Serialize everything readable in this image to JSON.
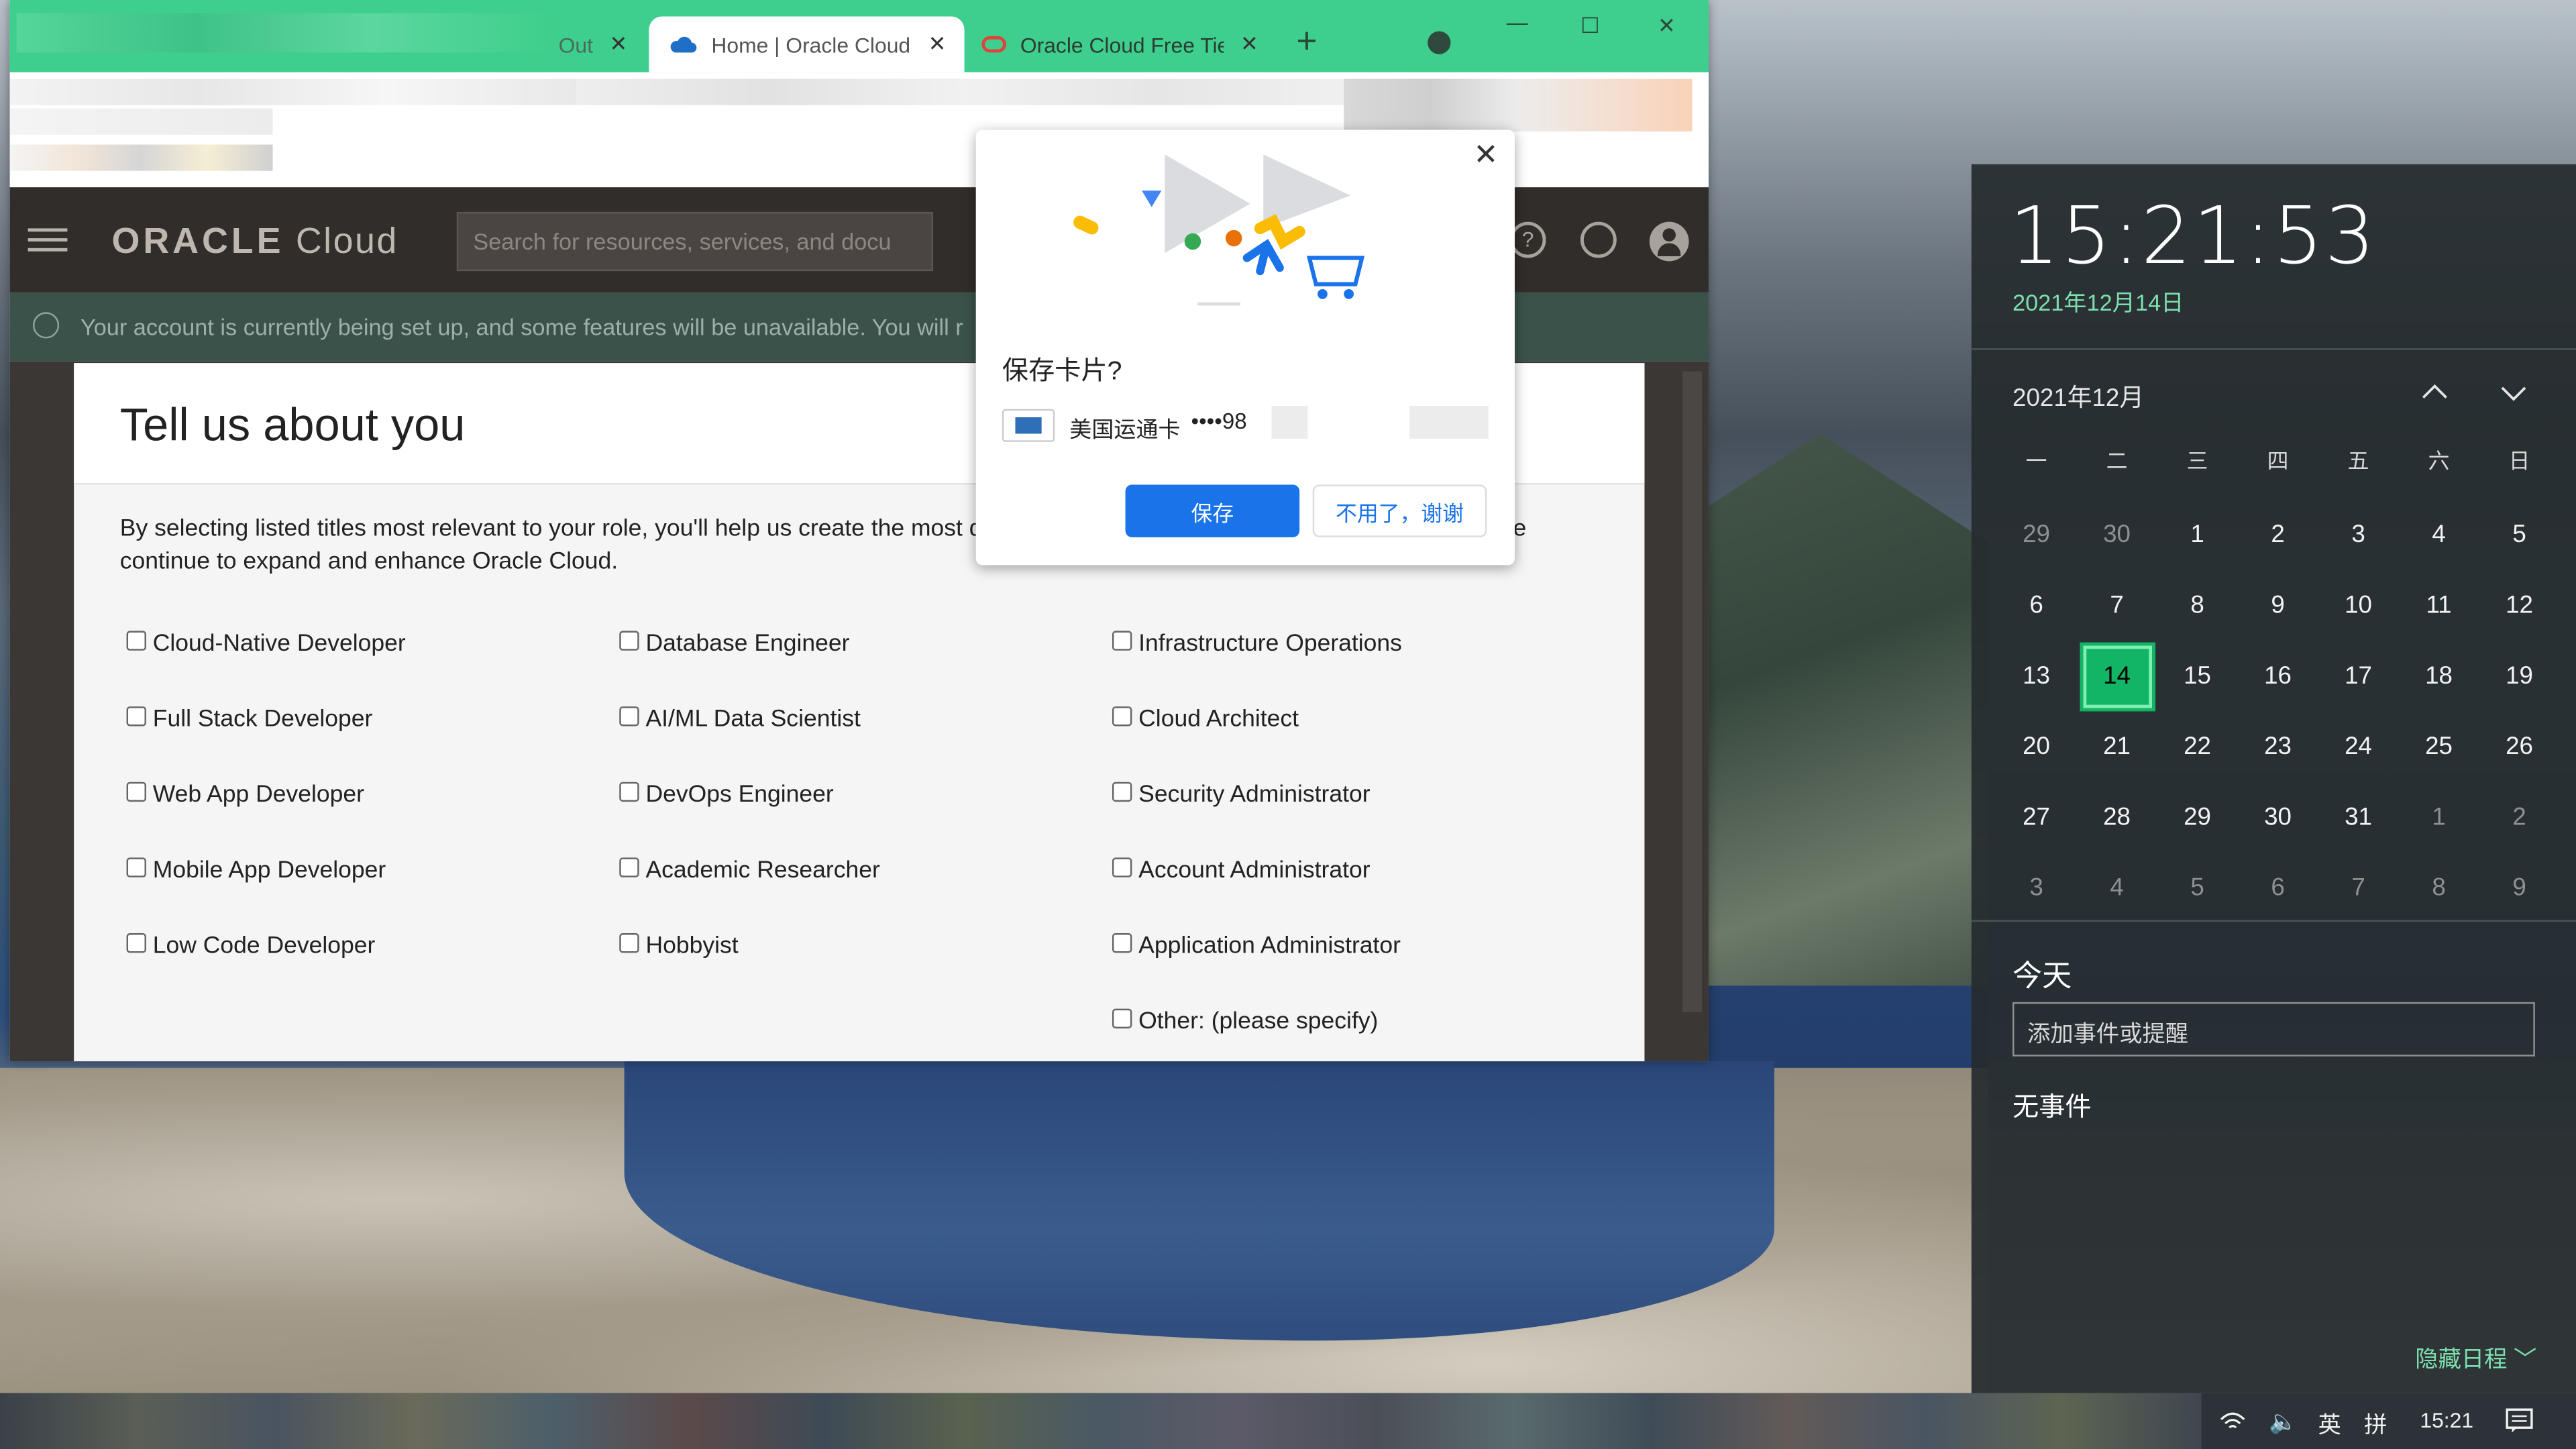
{
  "browser": {
    "tabs": [
      {
        "title": "Out"
      },
      {
        "title": "Home | Oracle Cloud"
      },
      {
        "title": "Oracle Cloud Free Tie"
      }
    ],
    "new_tab": "+",
    "controls": {
      "minimize": "—",
      "maximize": "☐",
      "close": "✕"
    }
  },
  "oracle": {
    "logo_oracle": "ORACLE",
    "logo_cloud": " Cloud",
    "search_placeholder": "Search for resources, services, and docu",
    "notice": "Your account is currently being set up, and some features will be unavailable. You will r"
  },
  "modal": {
    "title": "Tell us about you",
    "intro_line1": "By selecting listed titles most relevant to your role, you'll help us create the most di",
    "intro_line1_tail": "e",
    "intro_line2": "continue to expand and enhance Oracle Cloud.",
    "options": [
      [
        "Cloud-Native Developer",
        "Database Engineer",
        "Infrastructure Operations"
      ],
      [
        "Full Stack Developer",
        "AI/ML Data Scientist",
        "Cloud Architect"
      ],
      [
        "Web App Developer",
        "DevOps Engineer",
        "Security Administrator"
      ],
      [
        "Mobile App Developer",
        "Academic Researcher",
        "Account Administrator"
      ],
      [
        "Low Code Developer",
        "Hobbyist",
        "Application Administrator"
      ],
      [
        "",
        "",
        "Other: (please specify)"
      ]
    ]
  },
  "save_card_popup": {
    "title": "保存卡片?",
    "card_name": "美国运通卡",
    "card_number": "••••98",
    "save_label": "保存",
    "decline_label": "不用了，谢谢",
    "close": "✕"
  },
  "calendar_flyout": {
    "time": "15:21:53",
    "date": "2021年12月14日",
    "month_label": "2021年12月",
    "weekdays": [
      "一",
      "二",
      "三",
      "四",
      "五",
      "六",
      "日"
    ],
    "weeks": [
      [
        "29",
        "30",
        "1",
        "2",
        "3",
        "4",
        "5"
      ],
      [
        "6",
        "7",
        "8",
        "9",
        "10",
        "11",
        "12"
      ],
      [
        "13",
        "14",
        "15",
        "16",
        "17",
        "18",
        "19"
      ],
      [
        "20",
        "21",
        "22",
        "23",
        "24",
        "25",
        "26"
      ],
      [
        "27",
        "28",
        "29",
        "30",
        "31",
        "1",
        "2"
      ],
      [
        "3",
        "4",
        "5",
        "6",
        "7",
        "8",
        "9"
      ]
    ],
    "today_label": "今天",
    "event_placeholder": "添加事件或提醒",
    "no_events": "无事件",
    "hide_agenda": "隐藏日程"
  },
  "taskbar": {
    "ime_lang": "英",
    "ime_mode": "拼",
    "clock": "15:21"
  }
}
